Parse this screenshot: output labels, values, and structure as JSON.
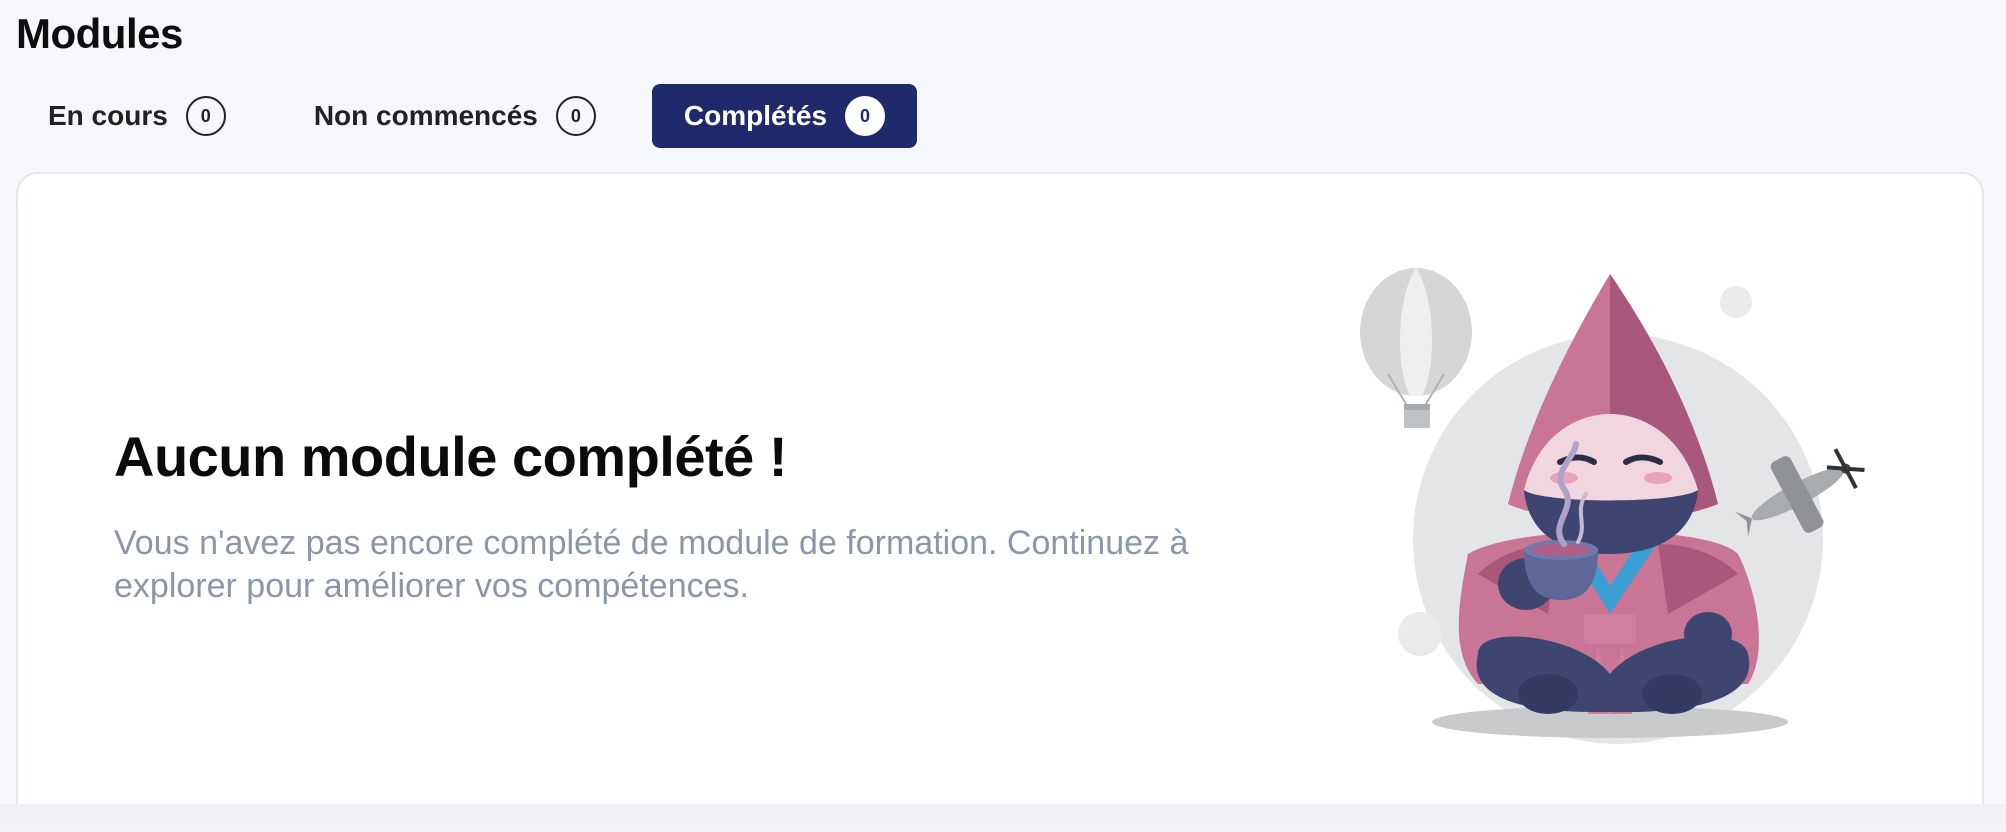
{
  "page": {
    "title": "Modules"
  },
  "tabs": [
    {
      "label": "En cours",
      "count": "0",
      "active": false
    },
    {
      "label": "Non commencés",
      "count": "0",
      "active": false
    },
    {
      "label": "Complétés",
      "count": "0",
      "active": true
    }
  ],
  "empty_state": {
    "title": "Aucun module complété !",
    "description": "Vous n'avez pas encore complété de module de formation. Continuez à explorer pour améliorer vos compétences.",
    "illustration": "ninja-drinking-tea-illustration"
  },
  "colors": {
    "background": "#f6f7fb",
    "active_tab": "#1e2a6b",
    "muted_text": "#8b97a8",
    "hood_pink": "#c87596",
    "ninja_navy": "#3d4570"
  }
}
